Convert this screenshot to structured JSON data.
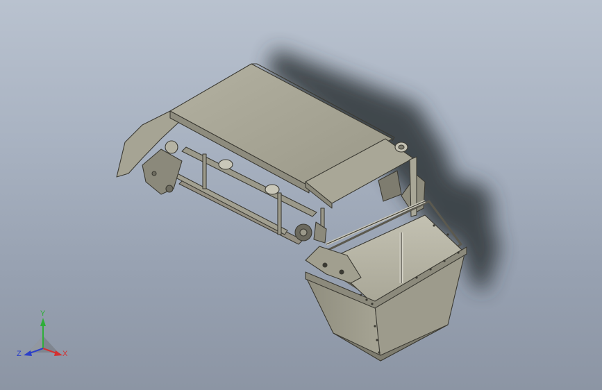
{
  "viewport": {
    "background_top": "#b9c2cf",
    "background_bottom": "#8c95a4"
  },
  "model": {
    "description_icon": "conveyor-hopper-assembly",
    "body_color": "#a19f8f",
    "body_light": "#b8b6a6",
    "body_dark": "#7d7b6d",
    "edge_color": "#3b3a33",
    "shadow_color": "#2e3338"
  },
  "triad": {
    "x_label": "X",
    "y_label": "Y",
    "z_label": "Z",
    "x_color": "#d43030",
    "y_color": "#2fae3a",
    "z_color": "#2b3fc9"
  }
}
